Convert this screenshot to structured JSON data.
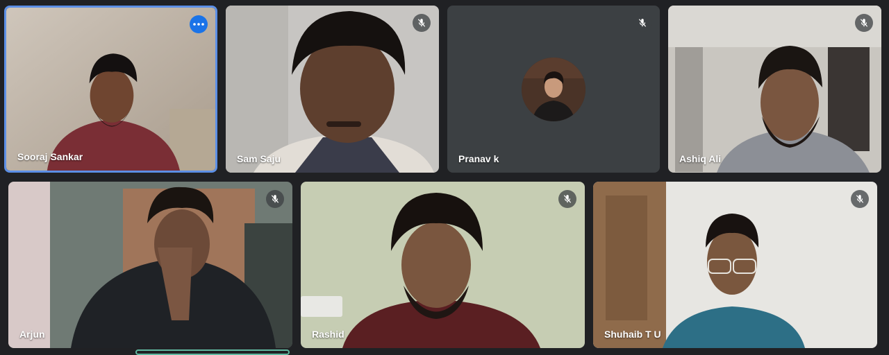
{
  "participants": [
    {
      "name": "Sooraj Sankar",
      "active": true,
      "muted": false,
      "icon": "more-options-icon"
    },
    {
      "name": "Sam Saju",
      "active": false,
      "muted": true,
      "icon": "mic-off-icon"
    },
    {
      "name": "Pranav k",
      "active": false,
      "muted": true,
      "icon": "mic-off-icon",
      "camera": "off"
    },
    {
      "name": "Ashiq Ali",
      "active": false,
      "muted": true,
      "icon": "mic-off-icon"
    },
    {
      "name": "Arjun",
      "active": false,
      "muted": true,
      "icon": "mic-off-icon"
    },
    {
      "name": "Rashid",
      "active": false,
      "muted": true,
      "icon": "mic-off-icon"
    },
    {
      "name": "Shuhaib T U",
      "active": false,
      "muted": true,
      "icon": "mic-off-icon"
    }
  ],
  "colors": {
    "background": "#202124",
    "active_border": "#5c8fe6",
    "more_button": "#1a73e8",
    "camera_off_tile": "#3c4043"
  }
}
